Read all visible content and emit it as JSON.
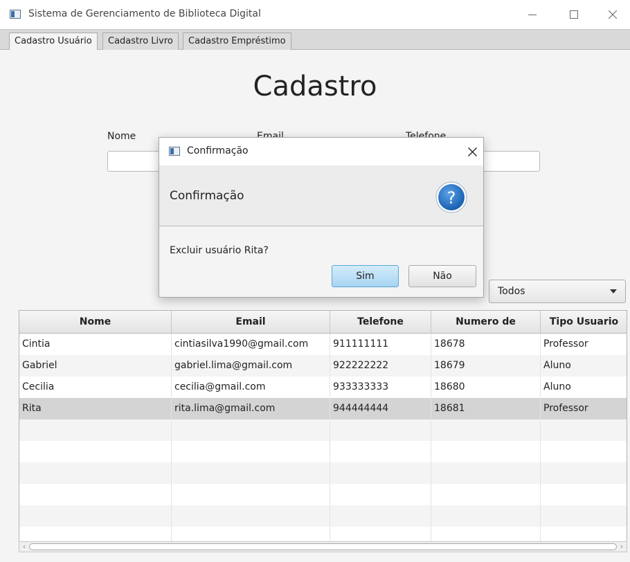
{
  "window": {
    "title": "Sistema de Gerenciamento de Biblioteca Digital"
  },
  "tabs": [
    {
      "label": "Cadastro Usuário",
      "active": true
    },
    {
      "label": "Cadastro Livro",
      "active": false
    },
    {
      "label": "Cadastro Empréstimo",
      "active": false
    }
  ],
  "form": {
    "heading": "Cadastro",
    "nome_label": "Nome",
    "email_label": "Email",
    "telefone_label": "Telefone",
    "nome_value": "",
    "email_value": "",
    "telefone_value": ""
  },
  "filter": {
    "selected": "Todos"
  },
  "table": {
    "columns": [
      "Nome",
      "Email",
      "Telefone",
      "Numero de Registro",
      "Tipo Usuario"
    ],
    "rows": [
      [
        "Cintia",
        "cintiasilva1990@gmail.com",
        "911111111",
        "18678",
        "Professor"
      ],
      [
        "Gabriel",
        "gabriel.lima@gmail.com",
        "922222222",
        "18679",
        "Aluno"
      ],
      [
        "Cecilia",
        "cecilia@gmail.com",
        "933333333",
        "18680",
        "Aluno"
      ],
      [
        "Rita",
        "rita.lima@gmail.com",
        "944444444",
        "18681",
        "Professor"
      ]
    ],
    "selected_row": 3
  },
  "dialog": {
    "title": "Confirmação",
    "header_text": "Confirmação",
    "message": "Excluir usuário Rita?",
    "yes_label": "Sim",
    "no_label": "Não"
  },
  "colors": {
    "accent": "#1f6fc5",
    "selected_row": "#d4d4d4",
    "default_button": "#a8d4f2"
  },
  "icons": {
    "app": "window-app-icon",
    "minimize": "minimize-icon",
    "maximize": "maximize-icon",
    "close": "close-icon",
    "question": "question-icon",
    "dropdown": "chevron-down-icon"
  }
}
